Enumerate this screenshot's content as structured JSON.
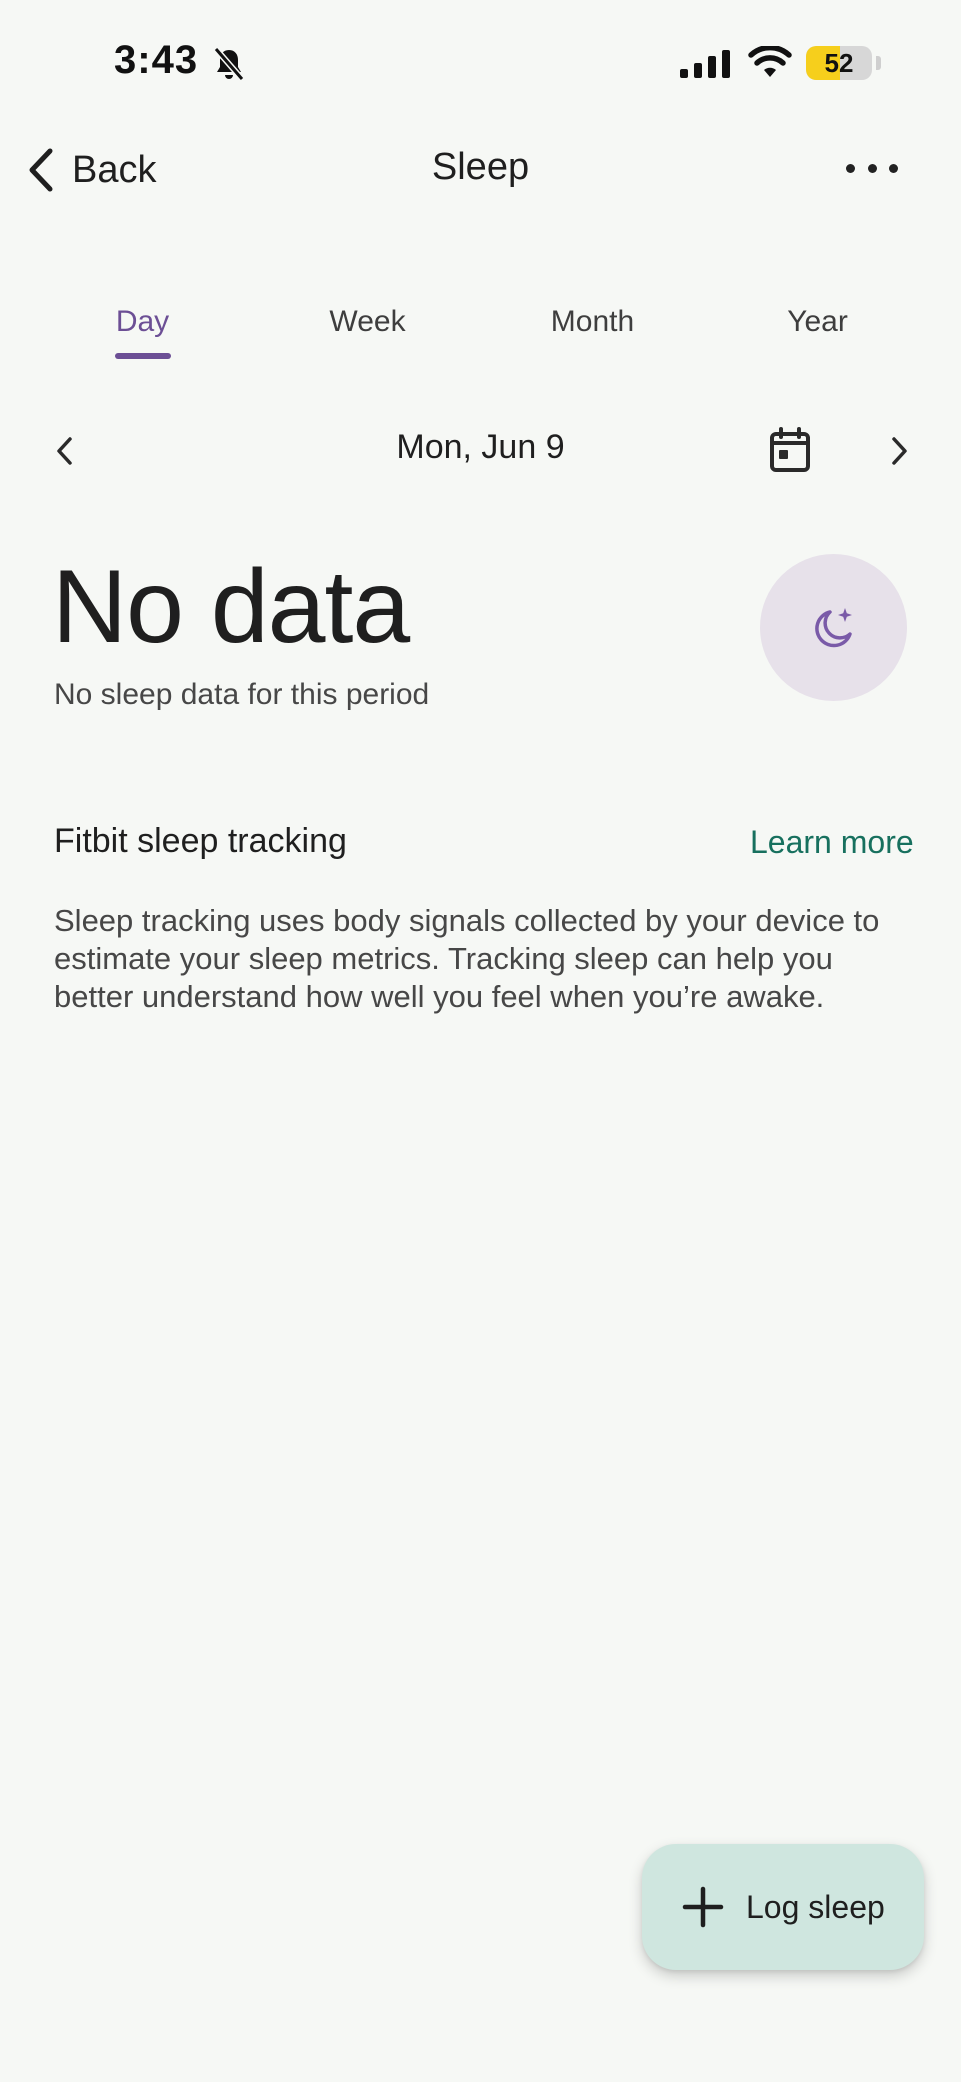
{
  "status_bar": {
    "time": "3:43",
    "battery": "52",
    "battery_level": 0.52,
    "icons": [
      "bell-slash-icon",
      "cellular-signal-icon",
      "wifi-icon",
      "battery-icon"
    ]
  },
  "header": {
    "back_label": "Back",
    "title": "Sleep",
    "icons": [
      "chevron-left-icon",
      "more-horizontal-icon"
    ]
  },
  "tabs": [
    {
      "label": "Day",
      "active": true
    },
    {
      "label": "Week",
      "active": false
    },
    {
      "label": "Month",
      "active": false
    },
    {
      "label": "Year",
      "active": false
    }
  ],
  "date_nav": {
    "date": "Mon, Jun 9",
    "icons": [
      "chevron-left-icon",
      "calendar-icon",
      "chevron-right-icon"
    ]
  },
  "summary": {
    "headline": "No data",
    "subtitle": "No sleep data for this period",
    "icon": "moon-stars-icon"
  },
  "tracking": {
    "title": "Fitbit sleep tracking",
    "link": "Learn more",
    "body": "Sleep tracking uses body signals collected by your device to estimate your sleep metrics. Tracking sleep can help you better understand how well you feel when you’re awake."
  },
  "fab": {
    "label": "Log sleep",
    "icon": "plus-icon"
  },
  "colors": {
    "background": "#f6f8f5",
    "accent": "#6c4f95",
    "link": "#17705e",
    "fab": "#cfe6df",
    "moon_circle": "#e7e1ea"
  }
}
